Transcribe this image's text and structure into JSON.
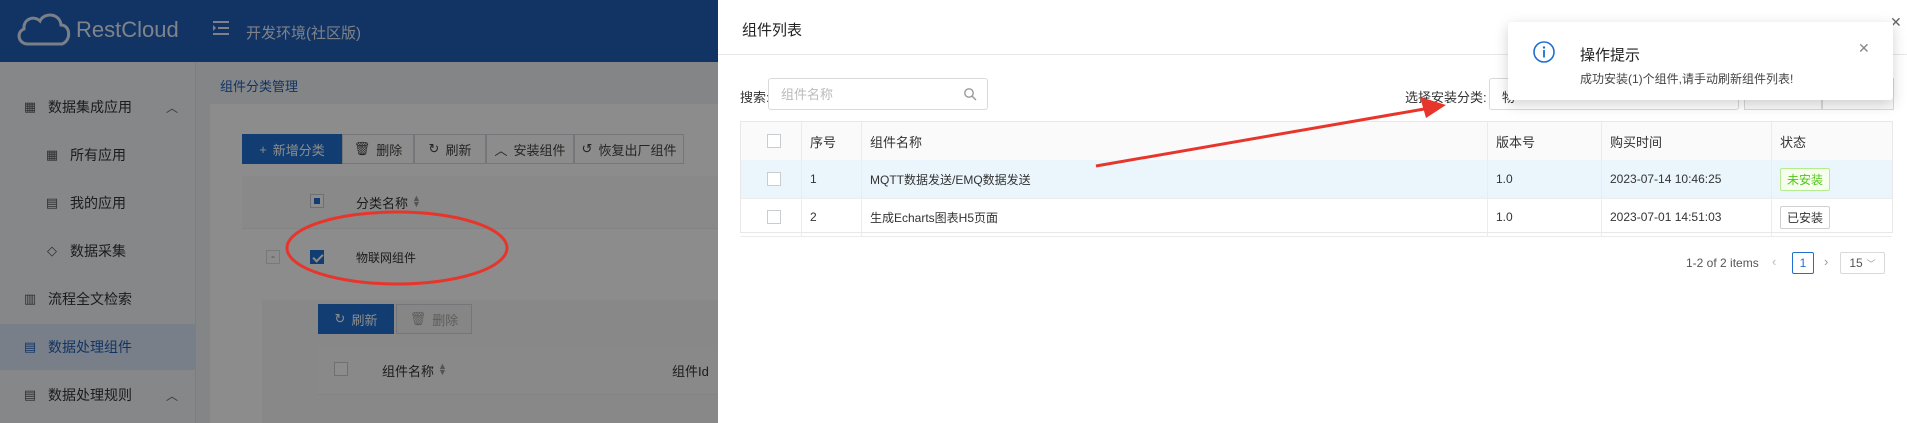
{
  "header": {
    "brand": "RestCloud",
    "env_title": "开发环境(社区版)"
  },
  "sidebar": {
    "items": [
      {
        "label": "数据集成应用",
        "icon": "grid-icon",
        "chevron": "^"
      },
      {
        "label": "所有应用",
        "icon": "grid-icon"
      },
      {
        "label": "我的应用",
        "icon": "document-icon"
      },
      {
        "label": "数据采集",
        "icon": "tag-icon"
      },
      {
        "label": "流程全文检索",
        "icon": "search-doc-icon"
      },
      {
        "label": "数据处理组件",
        "icon": "list-icon"
      },
      {
        "label": "数据处理规则",
        "icon": "doc-list-icon",
        "chevron": "^"
      }
    ]
  },
  "main": {
    "breadcrumb": "组件分类管理",
    "toolbar": {
      "add": "新增分类",
      "delete": "删除",
      "refresh": "刷新",
      "install": "安装组件",
      "restore": "恢复出厂组件"
    },
    "category_table": {
      "header": "分类名称",
      "rows": [
        {
          "expand": "-",
          "name": "物联网组件"
        }
      ]
    },
    "sub_toolbar": {
      "refresh": "刷新",
      "delete": "删除"
    },
    "component_table": {
      "col_name": "组件名称",
      "col_id": "组件Id"
    }
  },
  "drawer": {
    "title": "组件列表",
    "search_label": "搜索:",
    "search_placeholder": "组件名称",
    "category_label": "选择安装分类:",
    "category_value": "物",
    "table": {
      "headers": [
        "序号",
        "组件名称",
        "版本号",
        "购买时间",
        "状态"
      ],
      "rows": [
        {
          "no": "1",
          "name": "MQTT数据发送/EMQ数据发送",
          "version": "1.0",
          "time": "2023-07-14 10:46:25",
          "status": "未安装"
        },
        {
          "no": "2",
          "name": "生成Echarts图表H5页面",
          "version": "1.0",
          "time": "2023-07-01 14:51:03",
          "status": "已安装"
        }
      ]
    },
    "pagination": {
      "summary": "1-2 of 2 items",
      "current": "1",
      "page_size": "15"
    }
  },
  "notification": {
    "title": "操作提示",
    "message": "成功安装(1)个组件,请手动刷新组件列表!"
  },
  "colors": {
    "header_bg": "#1f5fb8",
    "primary": "#1f6fd0",
    "annotation": "#e8352b",
    "installed_tag": "#52c41a"
  }
}
